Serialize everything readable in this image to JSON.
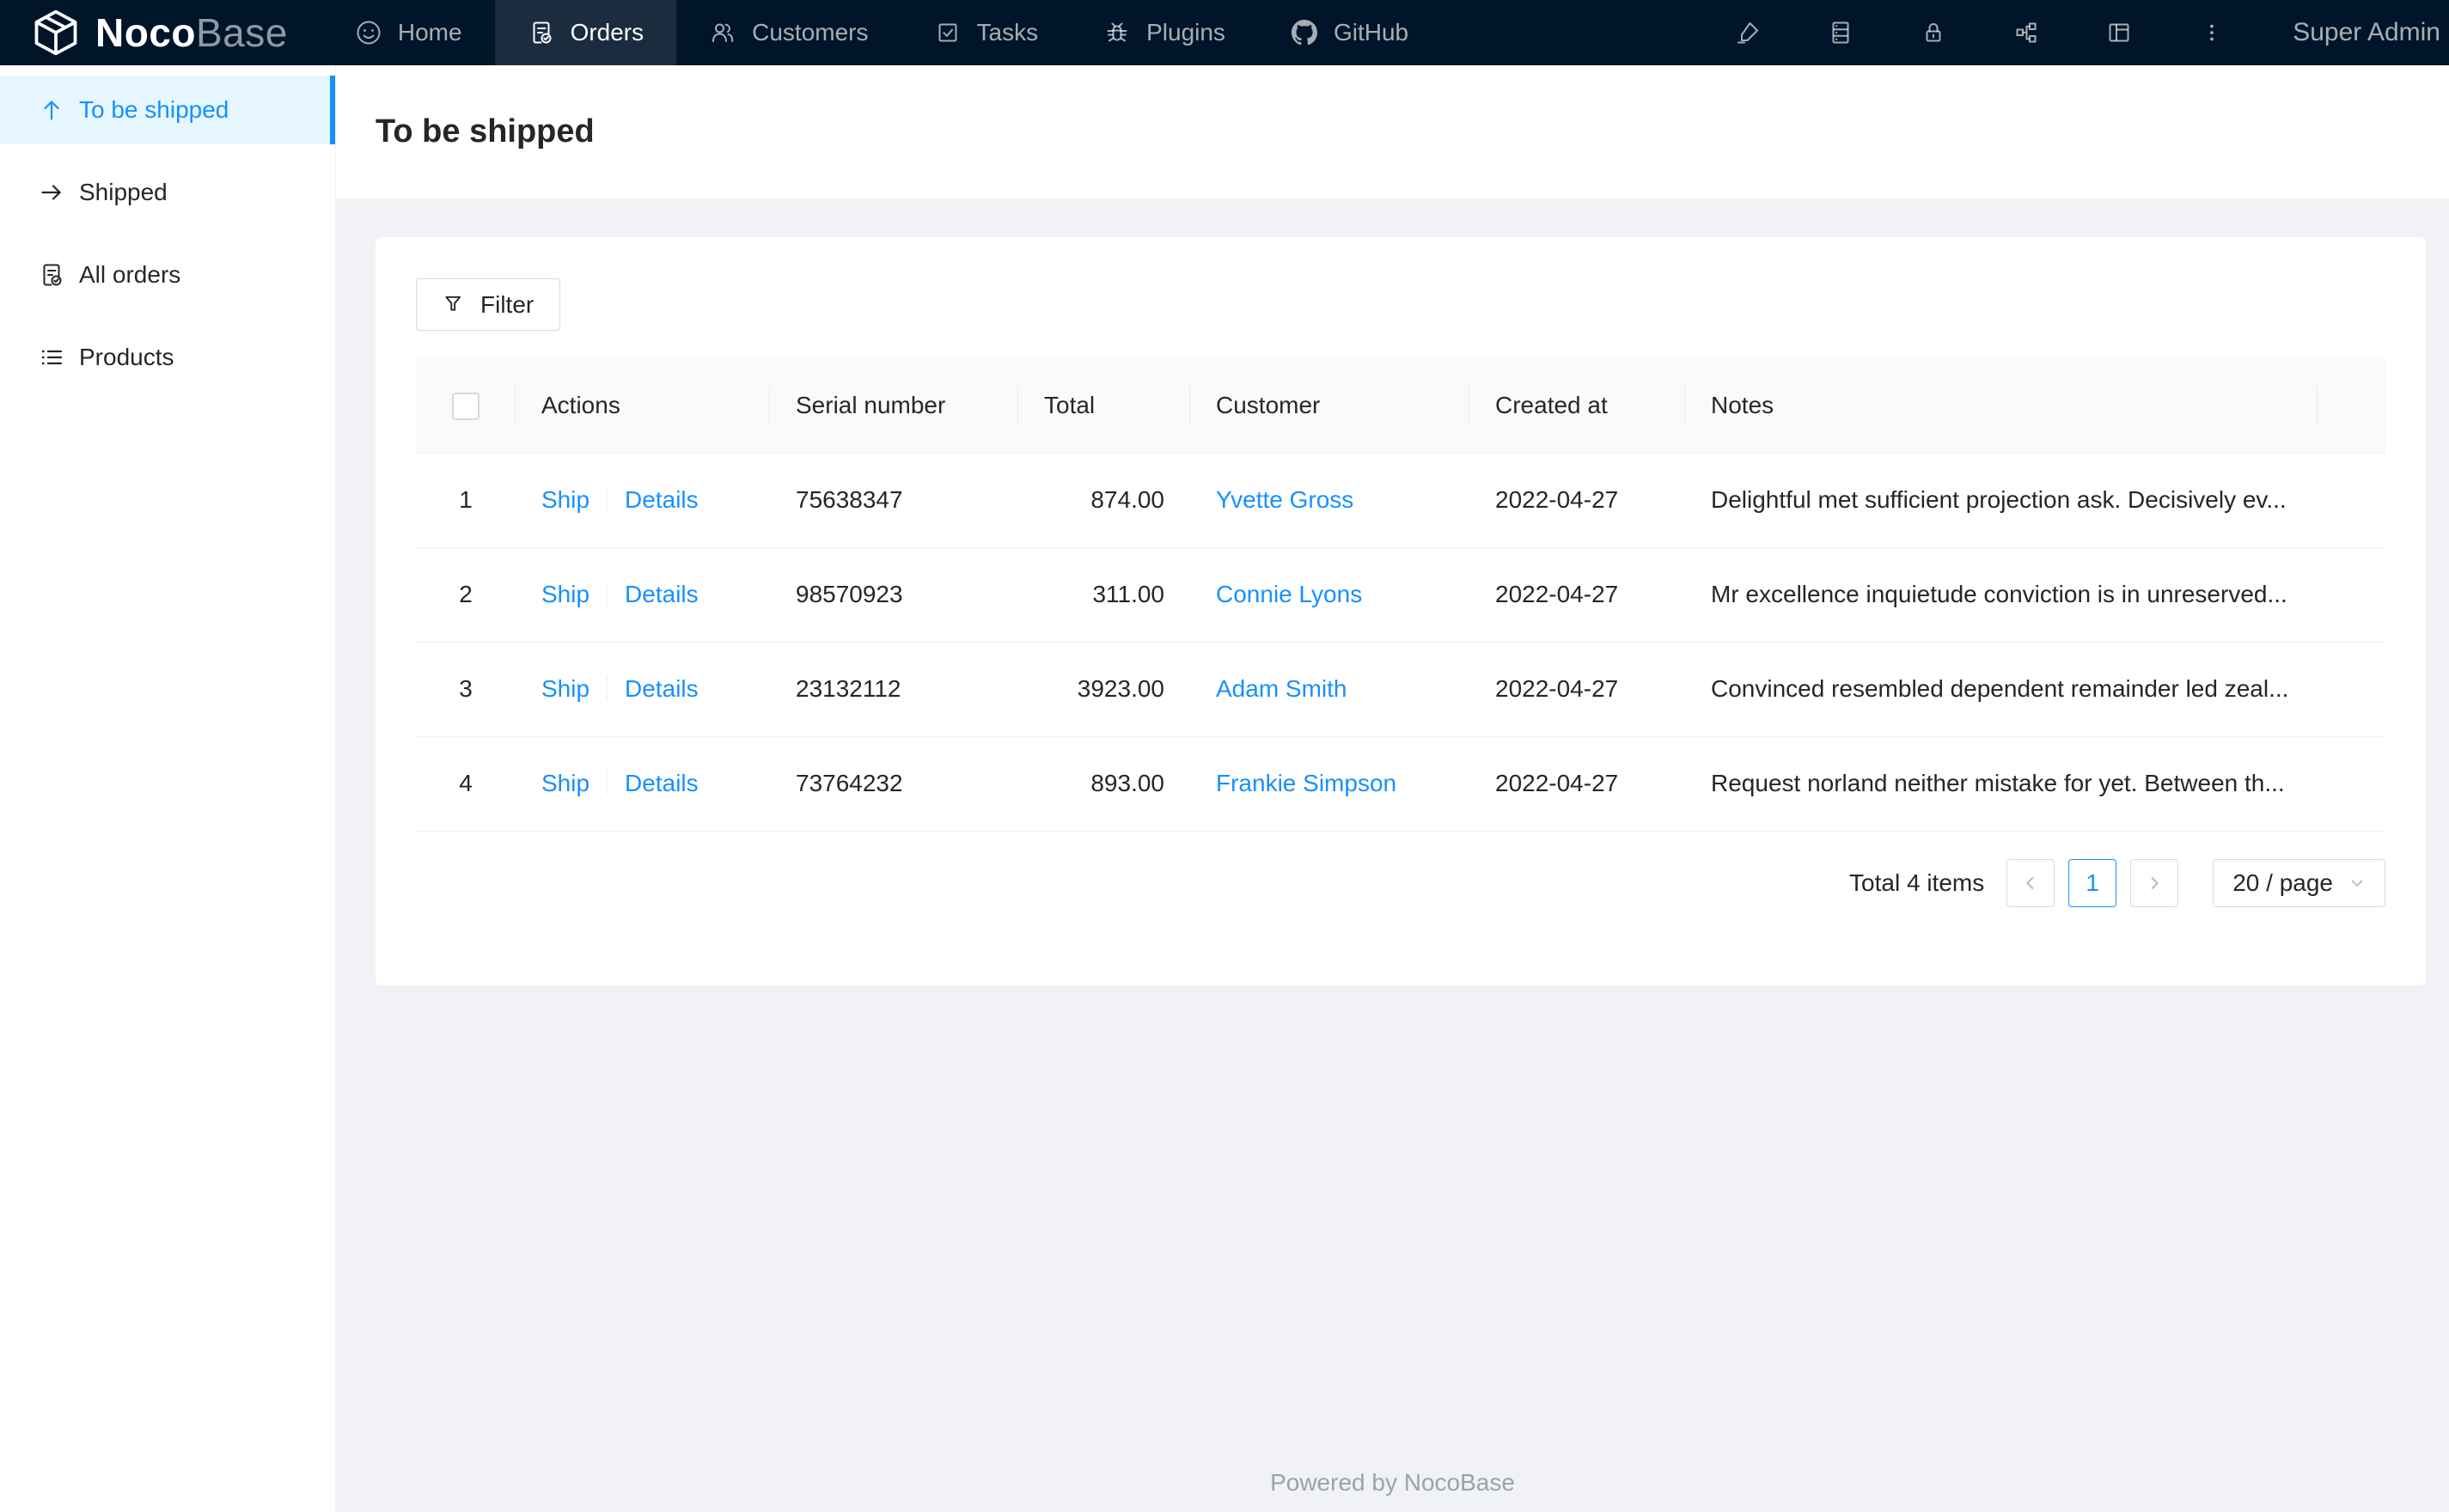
{
  "nav": {
    "logo": {
      "name": "Noco",
      "suffix": "Base"
    },
    "tabs": [
      {
        "label": "Home",
        "icon": "smiley-icon"
      },
      {
        "label": "Orders",
        "icon": "file-done-icon"
      },
      {
        "label": "Customers",
        "icon": "team-icon"
      },
      {
        "label": "Tasks",
        "icon": "check-square-icon"
      },
      {
        "label": "Plugins",
        "icon": "bug-icon"
      },
      {
        "label": "GitHub",
        "icon": "github-icon"
      }
    ],
    "right_icons": [
      "highlighter-icon",
      "database-icon",
      "lock-icon",
      "partition-icon",
      "layout-icon",
      "ellipsis-vertical-icon"
    ],
    "user": "Super Admin"
  },
  "sidebar": {
    "items": [
      {
        "label": "To be shipped",
        "icon": "arrow-up-icon",
        "active": true
      },
      {
        "label": "Shipped",
        "icon": "arrow-right-icon",
        "active": false
      },
      {
        "label": "All orders",
        "icon": "file-done-icon",
        "active": false
      },
      {
        "label": "Products",
        "icon": "unordered-list-icon",
        "active": false
      }
    ]
  },
  "page": {
    "title": "To be shipped"
  },
  "toolbar": {
    "filter_label": "Filter"
  },
  "table": {
    "columns": {
      "actions": "Actions",
      "serial": "Serial number",
      "total": "Total",
      "customer": "Customer",
      "created_at": "Created at",
      "notes": "Notes"
    },
    "action_labels": {
      "ship": "Ship",
      "details": "Details"
    },
    "rows": [
      {
        "index": "1",
        "serial": "75638347",
        "total": "874.00",
        "customer": "Yvette Gross",
        "created_at": "2022-04-27",
        "notes": "Delightful met sufficient projection ask. Decisively ev..."
      },
      {
        "index": "2",
        "serial": "98570923",
        "total": "311.00",
        "customer": "Connie Lyons",
        "created_at": "2022-04-27",
        "notes": "Mr excellence inquietude conviction is in unreserved..."
      },
      {
        "index": "3",
        "serial": "23132112",
        "total": "3923.00",
        "customer": "Adam Smith",
        "created_at": "2022-04-27",
        "notes": "Convinced resembled dependent remainder led zeal..."
      },
      {
        "index": "4",
        "serial": "73764232",
        "total": "893.00",
        "customer": "Frankie Simpson",
        "created_at": "2022-04-27",
        "notes": "Request norland neither mistake for yet. Between th..."
      }
    ]
  },
  "pagination": {
    "total_text": "Total 4 items",
    "current_page": "1",
    "page_size": "20 / page"
  },
  "footer": {
    "text": "Powered by NocoBase"
  },
  "colors": {
    "accent": "#1890ff",
    "nav_bg": "#001529",
    "sidebar_active_bg": "#e6f7ff",
    "page_bg": "#f0f2f5",
    "table_header_bg": "#fafafa"
  }
}
